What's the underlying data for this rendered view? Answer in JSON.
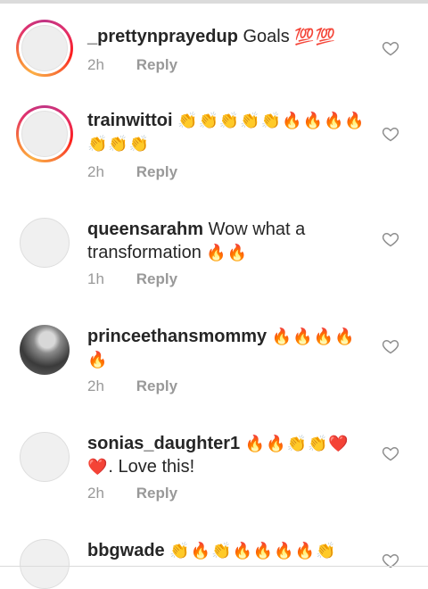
{
  "comments": [
    {
      "username": "_prettynprayedup",
      "text": "Goals",
      "emoji": "💯💯",
      "time": "2h",
      "reply": "Reply"
    },
    {
      "username": "trainwittoi",
      "text": "",
      "emoji": "👏👏👏👏👏🔥🔥🔥🔥👏👏👏",
      "time": "2h",
      "reply": "Reply"
    },
    {
      "username": "queensarahm",
      "text": "Wow what a transformation",
      "emoji": "🔥🔥",
      "time": "1h",
      "reply": "Reply"
    },
    {
      "username": "princeethansmommy",
      "text": "",
      "emoji": "🔥🔥🔥🔥🔥",
      "time": "2h",
      "reply": "Reply"
    },
    {
      "username": "sonias_daughter1",
      "text": "",
      "emoji": "🔥🔥👏👏❤️❤️",
      "text_after": ". Love this!",
      "time": "2h",
      "reply": "Reply"
    },
    {
      "username": "bbgwade",
      "text": "",
      "emoji": "👏🔥👏🔥🔥🔥🔥👏",
      "time": "",
      "reply": ""
    }
  ],
  "icons": {
    "like": "heart-outline-icon"
  }
}
